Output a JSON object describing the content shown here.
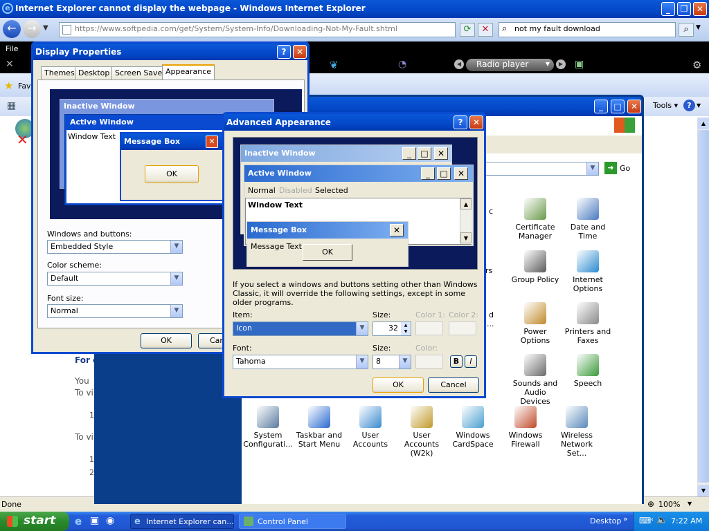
{
  "ie": {
    "title": "Internet Explorer cannot display the webpage - Windows Internet Explorer",
    "address": "https://www.softpedia.com/get/System/System-Info/Downloading-Not-My-Fault.shtml",
    "search": "not my fault download",
    "menu_file": "File",
    "toolbar_radio": "Radio player",
    "favorites_label": "Fav",
    "tools_label": "Tools",
    "status": "Done",
    "zoom": "100%",
    "page_text": {
      "heading": "For c",
      "p1": "You",
      "p2": "To vi",
      "n1": "1",
      "p3": "To vi",
      "n2": "1",
      "n3": "2"
    }
  },
  "control_panel": {
    "go_label": "Go",
    "partial_labels": [
      "c",
      "rs",
      "d",
      "..."
    ],
    "items": [
      {
        "label": "Certificate Manager",
        "icon": "certificate-icon",
        "color": "#6a9a4a"
      },
      {
        "label": "Date and Time",
        "icon": "clock-icon",
        "color": "#4a7ac0"
      },
      {
        "label": "Group Policy",
        "icon": "users-icon",
        "color": "#5a5a5a"
      },
      {
        "label": "Internet Options",
        "icon": "globe-icon",
        "color": "#2a8ad0"
      },
      {
        "label": "Power Options",
        "icon": "power-icon",
        "color": "#c08a2a"
      },
      {
        "label": "Printers and Faxes",
        "icon": "printer-icon",
        "color": "#8a8a8a"
      },
      {
        "label": "Sounds and Audio Devices",
        "icon": "speaker-icon",
        "color": "#6a6a6a"
      },
      {
        "label": "Speech",
        "icon": "speech-icon",
        "color": "#3a9a3a"
      },
      {
        "label": "System Configurati...",
        "icon": "system-config-icon",
        "color": "#5a7aa0"
      },
      {
        "label": "Taskbar and Start Menu",
        "icon": "taskbar-icon",
        "color": "#2a6ad0"
      },
      {
        "label": "User Accounts",
        "icon": "user-accounts-icon",
        "color": "#3a8ad0"
      },
      {
        "label": "User Accounts (W2k)",
        "icon": "user-accounts-w2k-icon",
        "color": "#c09a2a"
      },
      {
        "label": "Windows CardSpace",
        "icon": "cardspace-icon",
        "color": "#4aa0d0"
      },
      {
        "label": "Windows Firewall",
        "icon": "firewall-icon",
        "color": "#c04a2a"
      },
      {
        "label": "Wireless Network Set...",
        "icon": "wireless-icon",
        "color": "#5a8aba"
      }
    ]
  },
  "display_props": {
    "title": "Display Properties",
    "tabs": [
      "Themes",
      "Desktop",
      "Screen Saver",
      "Appearance"
    ],
    "preview_inactive": "Inactive Window",
    "preview_active": "Active Window",
    "preview_window_text": "Window Text",
    "preview_msgbox": "Message Box",
    "preview_ok": "OK",
    "windows_buttons_label": "Windows and buttons:",
    "windows_buttons_value": "Embedded Style",
    "color_scheme_label": "Color scheme:",
    "color_scheme_value": "Default",
    "font_size_label": "Font size:",
    "font_size_value": "Normal",
    "ok": "OK",
    "cancel_partial": "Car"
  },
  "advanced": {
    "title": "Advanced Appearance",
    "preview_inactive": "Inactive Window",
    "preview_active": "Active Window",
    "menu_normal": "Normal",
    "menu_disabled": "Disabled",
    "menu_selected": "Selected",
    "window_text": "Window Text",
    "msgbox_title": "Message Box",
    "msgbox_text": "Message Text",
    "msgbox_ok": "OK",
    "info": "If you select a windows and buttons setting other than Windows Classic, it will override the following settings, except in some older programs.",
    "item_label": "Item:",
    "item_value": "Icon",
    "size_label": "Size:",
    "size_value": "32",
    "color1_label": "Color 1:",
    "color2_label": "Color 2:",
    "font_label": "Font:",
    "font_value": "Tahoma",
    "font_size_label": "Size:",
    "font_size_value": "8",
    "color_label": "Color:",
    "bold": "B",
    "italic": "I",
    "ok": "OK",
    "cancel": "Cancel"
  },
  "taskbar": {
    "start": "start",
    "tasks": [
      "Internet Explorer can...",
      "Control Panel"
    ],
    "desktop_label": "Desktop",
    "clock": "7:22 AM"
  }
}
